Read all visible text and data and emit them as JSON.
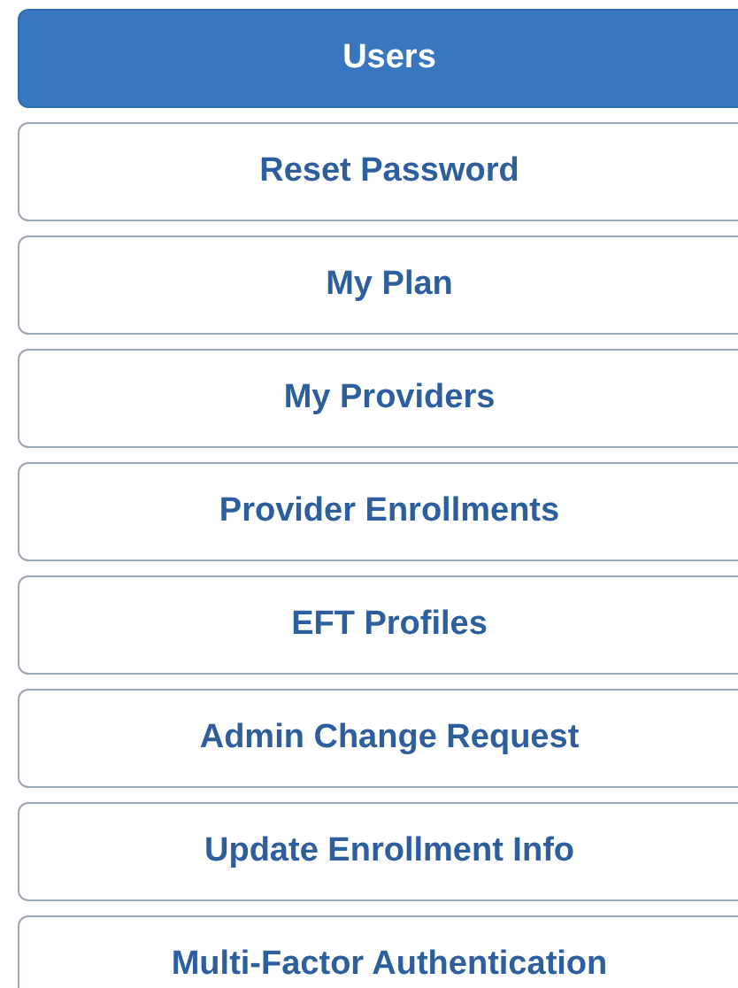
{
  "menu": [
    {
      "label": "Users",
      "selected": true
    },
    {
      "label": "Reset Password",
      "selected": false
    },
    {
      "label": "My Plan",
      "selected": false
    },
    {
      "label": "My Providers",
      "selected": false
    },
    {
      "label": "Provider Enrollments",
      "selected": false
    },
    {
      "label": "EFT Profiles",
      "selected": false
    },
    {
      "label": "Admin Change Request",
      "selected": false
    },
    {
      "label": "Update Enrollment Info",
      "selected": false
    },
    {
      "label": "Multi-Factor Authentication",
      "selected": false
    }
  ]
}
